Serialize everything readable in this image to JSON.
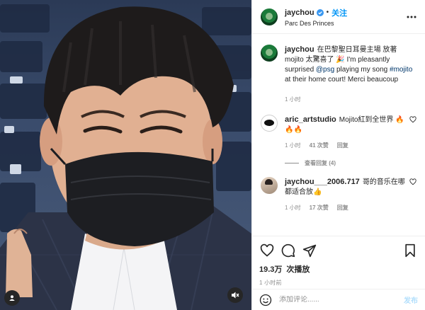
{
  "header": {
    "username": "jaychou",
    "dot": "•",
    "follow_label": "关注",
    "location": "Parc Des Princes",
    "icons": [
      "verified-badge-icon",
      "more-options-icon"
    ]
  },
  "caption": {
    "username": "jaychou",
    "text_before": "在巴黎聖日耳曼主場 放著 mojito 太驚喜了 🎉 I'm pleasantly surprised ",
    "mention": "@psg",
    "text_middle": " playing my song ",
    "hashtag": "#mojito",
    "text_after": " at their home court! Merci beaucoup",
    "time": "1 小时"
  },
  "comments": [
    {
      "username": "aric_artstudio",
      "text": "Mojito紅到全世界 🔥🔥🔥",
      "time": "1 小时",
      "likes": "41 次赞",
      "reply_label": "回复",
      "view_replies": "查看回复 (4)"
    },
    {
      "username": "jaychou___2006.717",
      "text": "哥的音乐在哪都适合放👍",
      "time": "1 小时",
      "likes": "17 次赞",
      "reply_label": "回复"
    }
  ],
  "actions": {
    "likes_count": "19.3万",
    "likes_label": "次播放",
    "post_time": "1 小时前",
    "icons": [
      "heart-icon",
      "comment-icon",
      "share-icon",
      "bookmark-icon"
    ]
  },
  "composer": {
    "placeholder": "添加评论......",
    "post_label": "发布"
  },
  "colors": {
    "link": "#0095f6",
    "tag": "#00376b",
    "muted": "#8e8e8e",
    "post_disabled": "#b2dffc",
    "verified": "#3897f0"
  }
}
